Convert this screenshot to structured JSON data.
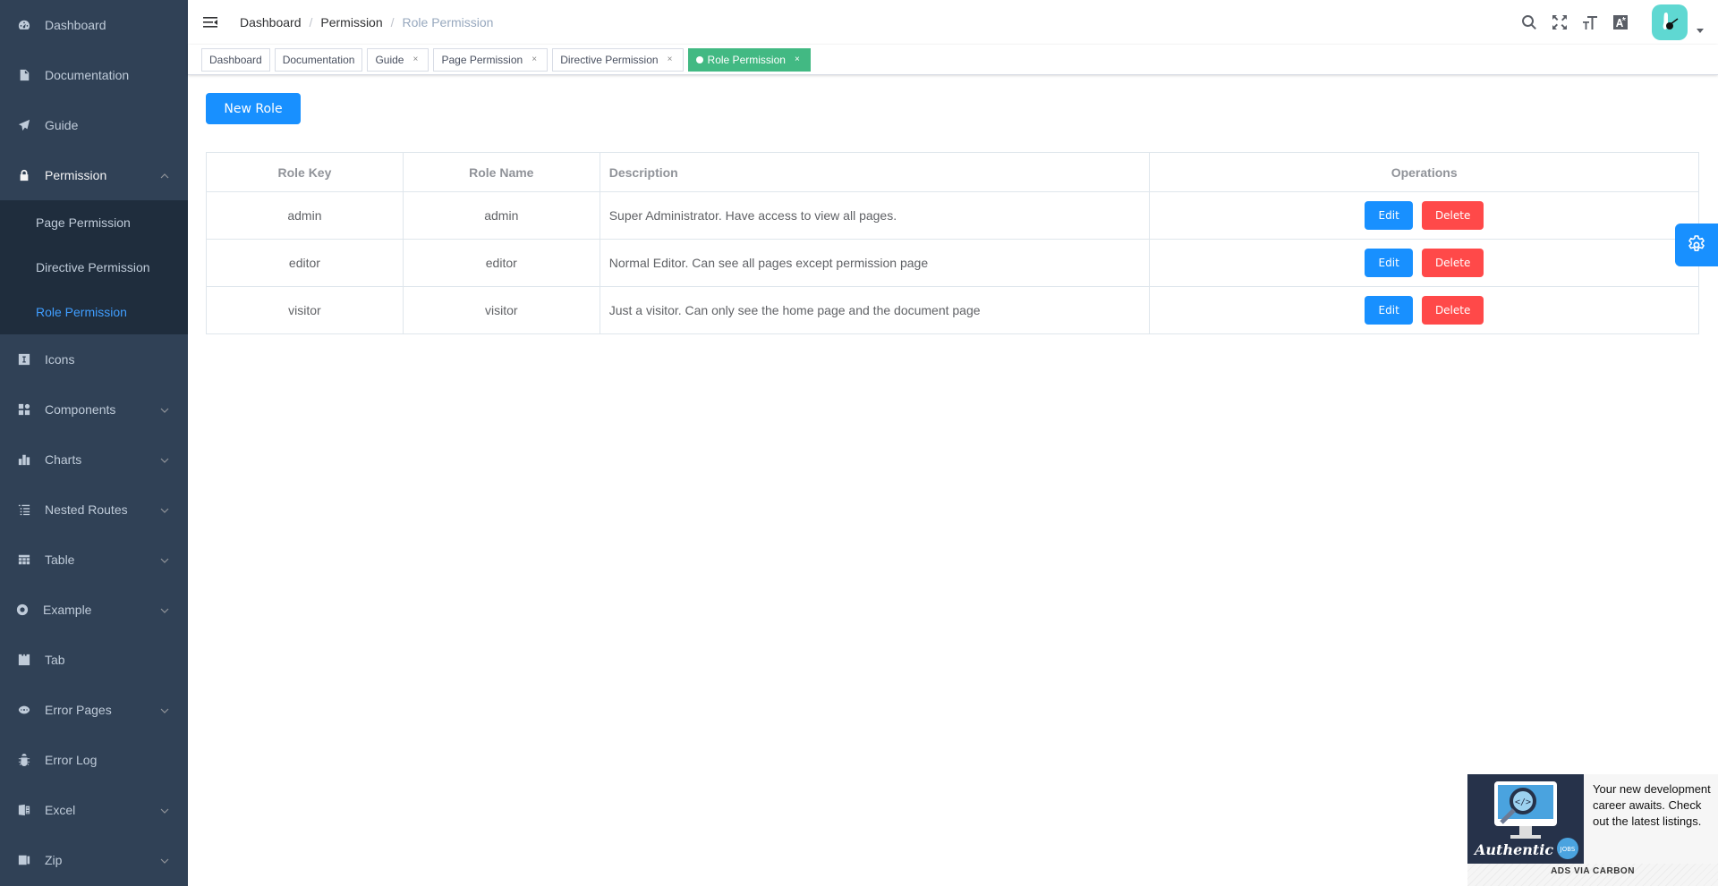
{
  "sidebar": {
    "items": [
      {
        "label": "Dashboard",
        "icon": "dashboard-icon"
      },
      {
        "label": "Documentation",
        "icon": "documentation-icon"
      },
      {
        "label": "Guide",
        "icon": "guide-icon"
      },
      {
        "label": "Permission",
        "icon": "lock-icon",
        "expanded": true,
        "children": [
          {
            "label": "Page Permission"
          },
          {
            "label": "Directive Permission"
          },
          {
            "label": "Role Permission",
            "active": true
          }
        ]
      },
      {
        "label": "Icons",
        "icon": "icons-icon"
      },
      {
        "label": "Components",
        "icon": "component-icon",
        "has_children": true
      },
      {
        "label": "Charts",
        "icon": "chart-icon",
        "has_children": true
      },
      {
        "label": "Nested Routes",
        "icon": "nested-icon",
        "has_children": true
      },
      {
        "label": "Table",
        "icon": "table-icon",
        "has_children": true
      },
      {
        "label": "Example",
        "icon": "example-icon",
        "has_children": true
      },
      {
        "label": "Tab",
        "icon": "tab-icon"
      },
      {
        "label": "Error Pages",
        "icon": "404-icon",
        "has_children": true
      },
      {
        "label": "Error Log",
        "icon": "bug-icon"
      },
      {
        "label": "Excel",
        "icon": "excel-icon",
        "has_children": true
      },
      {
        "label": "Zip",
        "icon": "zip-icon",
        "has_children": true
      }
    ]
  },
  "navbar": {
    "breadcrumb": [
      "Dashboard",
      "Permission",
      "Role Permission"
    ],
    "separator": "/",
    "right_icons": [
      "search-icon",
      "fullscreen-icon",
      "size-icon",
      "language-icon"
    ]
  },
  "tags": [
    {
      "label": "Dashboard",
      "closable": false
    },
    {
      "label": "Documentation",
      "closable": false
    },
    {
      "label": "Guide",
      "closable": true
    },
    {
      "label": "Page Permission",
      "closable": true
    },
    {
      "label": "Directive Permission",
      "closable": true
    },
    {
      "label": "Role Permission",
      "closable": true,
      "active": true
    }
  ],
  "tag_close_glyph": "×",
  "page": {
    "new_role_label": "New Role",
    "table": {
      "columns": [
        "Role Key",
        "Role Name",
        "Description",
        "Operations"
      ],
      "rows": [
        {
          "key": "admin",
          "name": "admin",
          "description": "Super Administrator. Have access to view all pages."
        },
        {
          "key": "editor",
          "name": "editor",
          "description": "Normal Editor. Can see all pages except permission page"
        },
        {
          "key": "visitor",
          "name": "visitor",
          "description": "Just a visitor. Can only see the home page and the document page"
        }
      ],
      "edit_label": "Edit",
      "delete_label": "Delete"
    }
  },
  "ad": {
    "text": "Your new development career awaits. Check out the latest listings.",
    "brand": "Authentic",
    "badge": "JOBS",
    "footer": "ADS VIA CARBON"
  },
  "colors": {
    "sidebar_bg": "#304156",
    "submenu_bg": "#1f2d3d",
    "active_menu": "#409eff",
    "active_tag": "#42b983",
    "primary": "#1890ff",
    "danger": "#ff4949"
  }
}
